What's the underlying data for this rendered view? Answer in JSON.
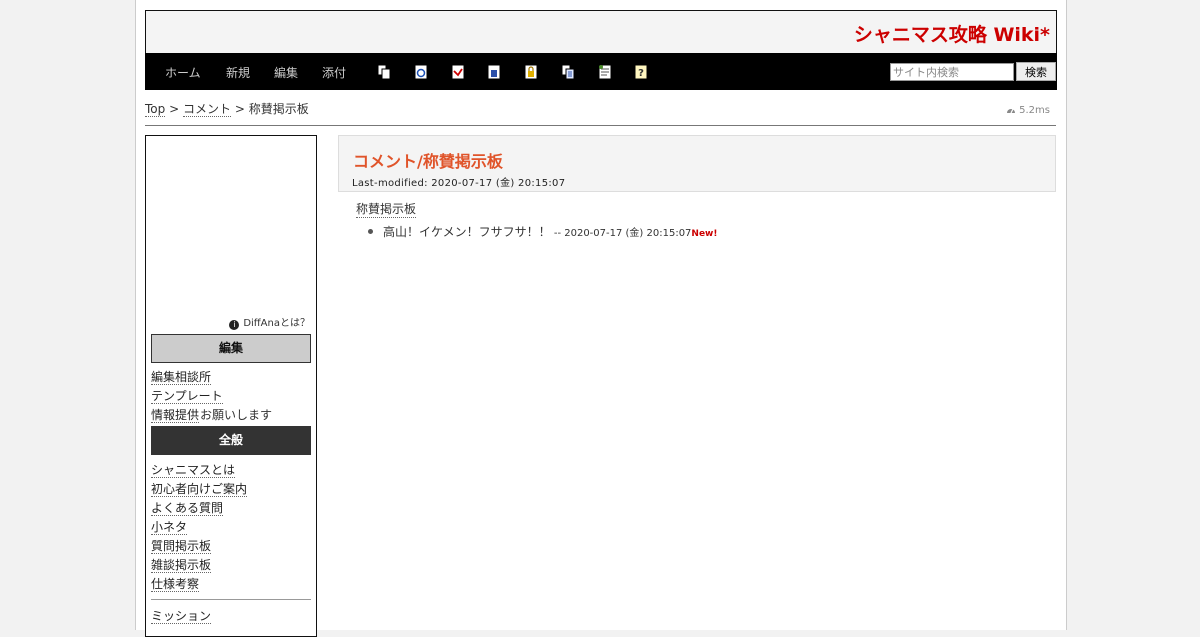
{
  "site": {
    "title": "シャニマス攻略 Wiki*"
  },
  "nav": {
    "links": [
      "ホーム",
      "新規",
      "編集",
      "添付"
    ],
    "tool_icons": [
      "copy-icon",
      "reload-icon",
      "diff-icon",
      "backup-icon",
      "freeze-icon",
      "list-icon",
      "recent-icon",
      "help-icon"
    ],
    "search": {
      "placeholder": "サイト内検索",
      "button": "検索"
    }
  },
  "breadcrumb": {
    "top": "Top",
    "sep": ">",
    "parent": "コメント",
    "current": "称賛掲示板"
  },
  "timer": "5.2ms",
  "sidebar": {
    "diffana_label": "DiffAnaとは？",
    "section_edit": "編集",
    "edit_links": [
      "編集相談所",
      "テンプレート"
    ],
    "info_link": "情報提供",
    "info_suffix": " お願いします",
    "section_general": "全般",
    "general_links": [
      "シャニマスとは",
      "初心者向けご案内",
      "よくある質問",
      "小ネタ",
      "質問掲示板",
      "雑談掲示板",
      "仕様考察"
    ],
    "mission_link": "ミッション"
  },
  "content": {
    "title": "コメント/称賛掲示板",
    "last_modified": "Last-modified: 2020-07-17 (金) 20:15:07",
    "board_link": "称賛掲示板",
    "comments": [
      {
        "text": "高山！イケメン！フサフサ！！",
        "meta": " -- 2020-07-17 (金) 20:15:07",
        "badge": "New!"
      }
    ]
  },
  "colors": {
    "title_red": "#cc0000",
    "page_title_orange": "#e0542a",
    "navbar": "#000000"
  }
}
